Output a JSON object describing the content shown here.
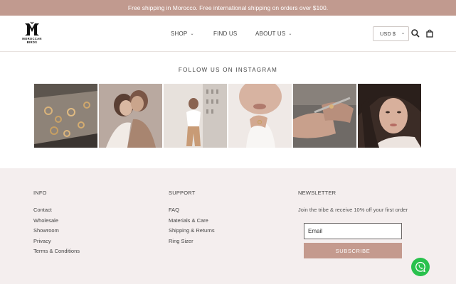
{
  "announcement": "Free shipping in Morocco. Free international shipping on orders over $100.",
  "brand": {
    "line1": "MOROCCAN",
    "line2": "BIRDS"
  },
  "nav": {
    "shop": "SHOP",
    "find_us": "FIND US",
    "about_us": "ABOUT US"
  },
  "currency": {
    "value": "USD $"
  },
  "icons": {
    "search": "search-icon",
    "cart": "cart-icon",
    "chevron": "chevron-down-icon",
    "whatsapp": "whatsapp-icon"
  },
  "instagram": {
    "title": "FOLLOW US ON INSTAGRAM",
    "posts": [
      "jewelry-display-photo",
      "two-women-embracing-photo",
      "woman-in-white-outfit-photo",
      "hand-with-ring-photo",
      "hands-crafting-jewelry-photo",
      "woman-portrait-photo"
    ]
  },
  "footer": {
    "info": {
      "title": "INFO",
      "links": [
        "Contact",
        "Wholesale",
        "Showroom",
        "Privacy",
        "Terms & Conditions"
      ]
    },
    "support": {
      "title": "SUPPORT",
      "links": [
        "FAQ",
        "Materials & Care",
        "Shipping & Returns",
        "Ring Sizer"
      ]
    },
    "newsletter": {
      "title": "NEWSLETTER",
      "text": "Join the tribe & receive 10% off your first order",
      "email_placeholder": "Email",
      "subscribe_label": "SUBSCRIBE"
    }
  },
  "colors": {
    "accent": "#c19a8f",
    "footer_bg": "#f4eeee",
    "whatsapp": "#29c14d"
  }
}
